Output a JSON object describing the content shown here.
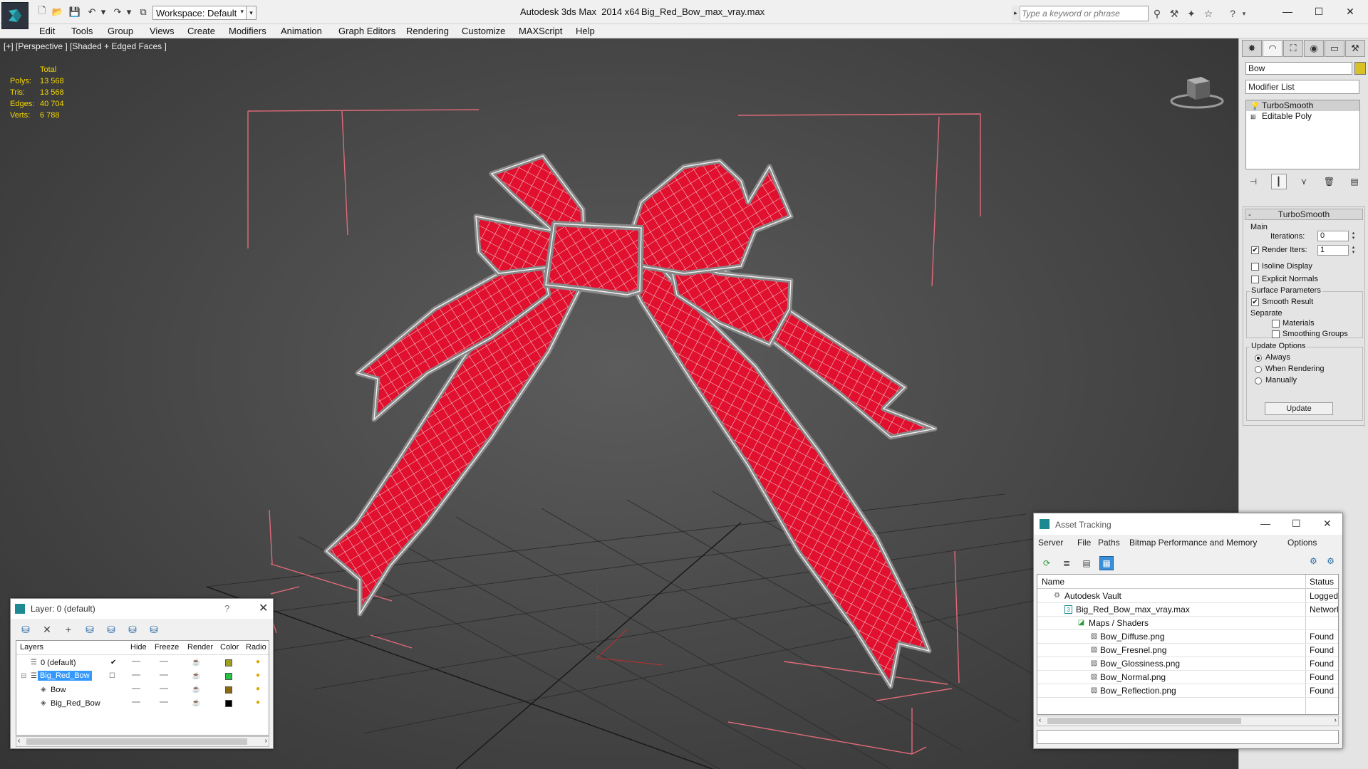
{
  "titlebar": {
    "app_title": "Autodesk 3ds Max  2014 x64",
    "file_title": "Big_Red_Bow_max_vray.max",
    "workspace_label": "Workspace: Default",
    "search_placeholder": "Type a keyword or phrase",
    "minimize": "—",
    "maximize": "☐",
    "close": "✕"
  },
  "menu": [
    "Edit",
    "Tools",
    "Group",
    "Views",
    "Create",
    "Modifiers",
    "Animation",
    "Graph Editors",
    "Rendering",
    "Customize",
    "MAXScript",
    "Help"
  ],
  "viewport": {
    "label": "[+] [Perspective ] [Shaded + Edged Faces ]",
    "stats": {
      "header": "Total",
      "rows": [
        {
          "label": "Polys:",
          "value": "13 568"
        },
        {
          "label": "Tris:",
          "value": "13 568"
        },
        {
          "label": "Edges:",
          "value": "40 704"
        },
        {
          "label": "Verts:",
          "value": "6 788"
        }
      ]
    }
  },
  "command_panel": {
    "object_name": "Bow",
    "object_color": "#d8c026",
    "modifier_list": "Modifier List",
    "stack": [
      "TurboSmooth",
      "Editable Poly"
    ],
    "rollout_title": "TurboSmooth",
    "main_group": "Main",
    "iterations_label": "Iterations:",
    "iterations_value": "0",
    "render_iters_label": "Render Iters:",
    "render_iters_value": "1",
    "isoline_display": "Isoline Display",
    "explicit_normals": "Explicit Normals",
    "surface_params": "Surface Parameters",
    "smooth_result": "Smooth Result",
    "separate": "Separate",
    "materials": "Materials",
    "smoothing_groups": "Smoothing Groups",
    "update_options": "Update Options",
    "always": "Always",
    "when_rendering": "When Rendering",
    "manually": "Manually",
    "update_button": "Update",
    "checks": {
      "render_iters": true,
      "isoline": false,
      "explicit_normals": false,
      "smooth_result": true,
      "materials": false,
      "smoothing_groups": false
    },
    "update_mode": "Always"
  },
  "layer_panel": {
    "title": "Layer: 0 (default)",
    "help": "?",
    "close": "✕",
    "columns": [
      "Layers",
      "Hide",
      "Freeze",
      "Render",
      "Color",
      "Radio"
    ],
    "rows": [
      {
        "name": "0 (default)",
        "color": "#a0a020",
        "active": true,
        "selected": false
      },
      {
        "name": "Big_Red_Bow",
        "color": "#28c040",
        "active": false,
        "selected": true
      },
      {
        "name": "Bow",
        "color": "#8a6a10",
        "active": false,
        "selected": false
      },
      {
        "name": "Big_Red_Bow",
        "color": "#000000",
        "active": false,
        "selected": false
      }
    ]
  },
  "asset_panel": {
    "title": "Asset Tracking",
    "menu": [
      "Server",
      "File",
      "Paths",
      "Bitmap Performance and Memory",
      "Options"
    ],
    "columns": [
      "Name",
      "Status"
    ],
    "rows": [
      {
        "name": "Autodesk Vault",
        "status": "Logged O",
        "indent": 0
      },
      {
        "name": "Big_Red_Bow_max_vray.max",
        "status": "Network",
        "indent": 1
      },
      {
        "name": "Maps / Shaders",
        "status": "",
        "indent": 2
      },
      {
        "name": "Bow_Diffuse.png",
        "status": "Found",
        "indent": 3
      },
      {
        "name": "Bow_Fresnel.png",
        "status": "Found",
        "indent": 3
      },
      {
        "name": "Bow_Glossiness.png",
        "status": "Found",
        "indent": 3
      },
      {
        "name": "Bow_Normal.png",
        "status": "Found",
        "indent": 3
      },
      {
        "name": "Bow_Reflection.png",
        "status": "Found",
        "indent": 3
      }
    ]
  },
  "colors": {
    "ribbon": "#e0102e",
    "wire": "#f0f0f0",
    "stats": "#f5d600",
    "bbox": "#e06070",
    "accent": "#3399ff"
  }
}
